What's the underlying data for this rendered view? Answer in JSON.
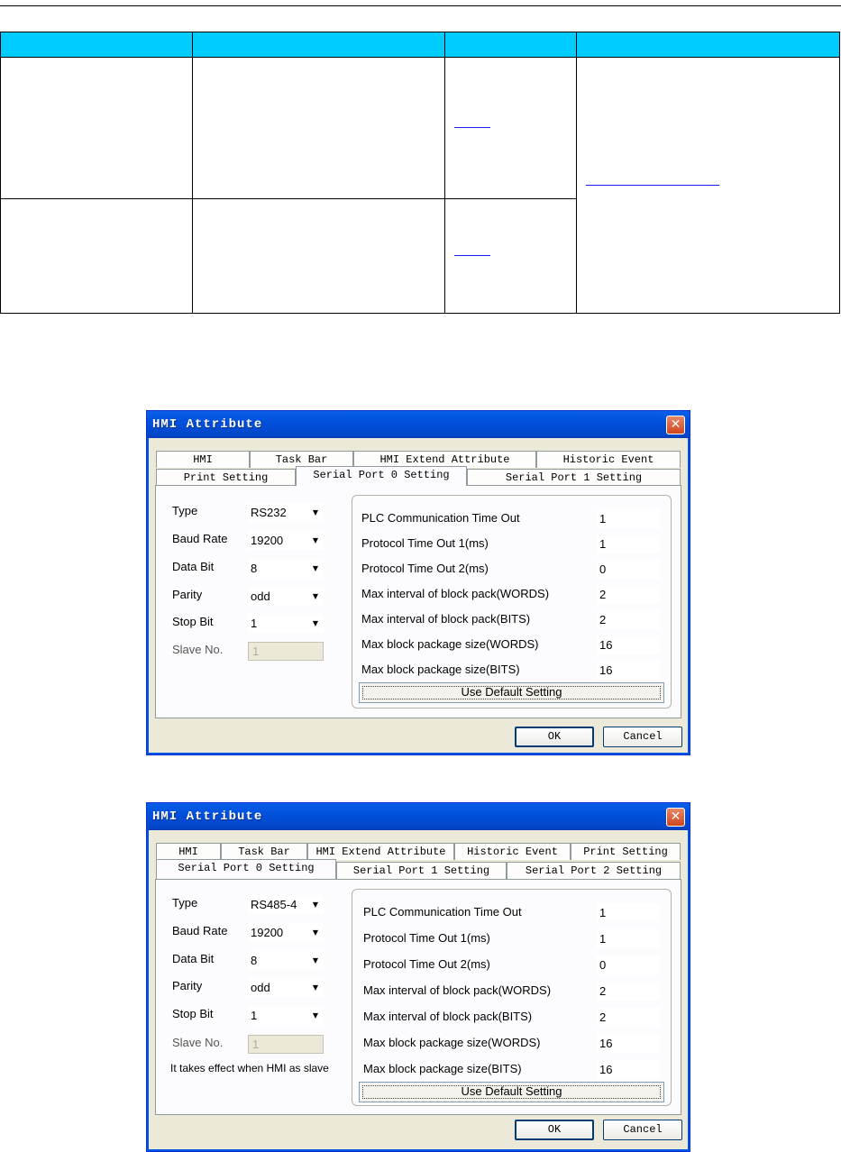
{
  "dialog1": {
    "title": "HMI Attribute",
    "tabs_row1": [
      "HMI",
      "Task Bar",
      "HMI Extend Attribute",
      "Historic Event"
    ],
    "tabs_row2": [
      "Print Setting",
      "Serial Port 0 Setting",
      "Serial Port 1 Setting"
    ],
    "active_tab": "Serial Port 0 Setting",
    "fields": [
      {
        "label": "Type",
        "value": "RS232"
      },
      {
        "label": "Baud Rate",
        "value": "19200"
      },
      {
        "label": "Data Bit",
        "value": "8"
      },
      {
        "label": "Parity",
        "value": "odd"
      },
      {
        "label": "Stop Bit",
        "value": "1"
      }
    ],
    "slave_label": "Slave No.",
    "slave_value": "1",
    "params": [
      {
        "label": "PLC Communication Time Out",
        "value": "1"
      },
      {
        "label": "Protocol Time Out 1(ms)",
        "value": "1"
      },
      {
        "label": "Protocol Time Out 2(ms)",
        "value": "0"
      },
      {
        "label": "Max interval of block pack(WORDS)",
        "value": "2"
      },
      {
        "label": "Max interval of block pack(BITS)",
        "value": "2"
      },
      {
        "label": "Max block package size(WORDS)",
        "value": "16"
      },
      {
        "label": "Max block package size(BITS)",
        "value": "16"
      }
    ],
    "default_button": "Use Default Setting",
    "ok_button": "OK",
    "cancel_button": "Cancel"
  },
  "dialog2": {
    "title": "HMI Attribute",
    "tabs_row1": [
      "HMI",
      "Task Bar",
      "HMI Extend Attribute",
      "Historic Event",
      "Print Setting"
    ],
    "tabs_row2": [
      "Serial Port 0 Setting",
      "Serial Port 1 Setting",
      "Serial Port 2 Setting"
    ],
    "active_tab": "Serial Port 0 Setting",
    "fields": [
      {
        "label": "Type",
        "value": "RS485-4"
      },
      {
        "label": "Baud Rate",
        "value": "19200"
      },
      {
        "label": "Data Bit",
        "value": "8"
      },
      {
        "label": "Parity",
        "value": "odd"
      },
      {
        "label": "Stop Bit",
        "value": "1"
      }
    ],
    "slave_label": "Slave No.",
    "slave_value": "1",
    "note": "It takes effect when HMI as slave",
    "params": [
      {
        "label": "PLC Communication Time Out",
        "value": "1"
      },
      {
        "label": "Protocol Time Out 1(ms)",
        "value": "1"
      },
      {
        "label": "Protocol Time Out 2(ms)",
        "value": "0"
      },
      {
        "label": "Max interval of block pack(WORDS)",
        "value": "2"
      },
      {
        "label": "Max interval of block pack(BITS)",
        "value": "2"
      },
      {
        "label": "Max block package size(WORDS)",
        "value": "16"
      },
      {
        "label": "Max block package size(BITS)",
        "value": "16"
      }
    ],
    "default_button": "Use Default Setting",
    "ok_button": "OK",
    "cancel_button": "Cancel"
  },
  "colors": {
    "table_header": "#00ccff",
    "link": "#1a1aff",
    "titlebar": "#0050dc",
    "dialog_face": "#ece9d8"
  }
}
